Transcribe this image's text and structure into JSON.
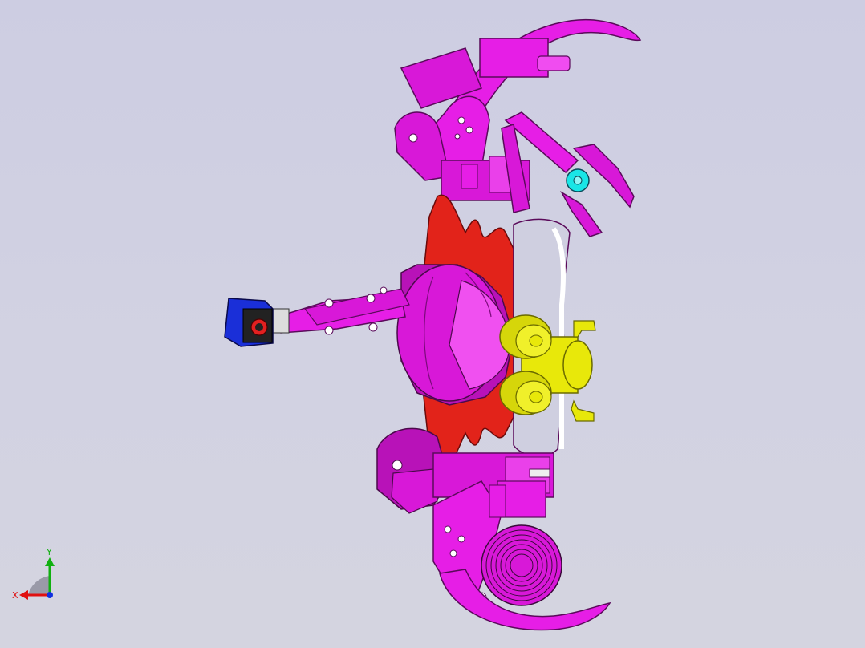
{
  "viewport": {
    "background": "#cdcde2",
    "model_colors": {
      "frame": "#e61ee6",
      "frame_dark": "#9c0f9c",
      "frame_light": "#f58cf5",
      "base_plate": "#e2231a",
      "wheels": "#e8e80a",
      "camera": "#1a2fd8",
      "gripper_hub": "#19e6e6",
      "spacer": "#eeeeee"
    }
  },
  "triad": {
    "x_label": "X",
    "y_label": "Y",
    "x_color": "#e01010",
    "y_color": "#10b010",
    "z_color": "#1030e0"
  }
}
